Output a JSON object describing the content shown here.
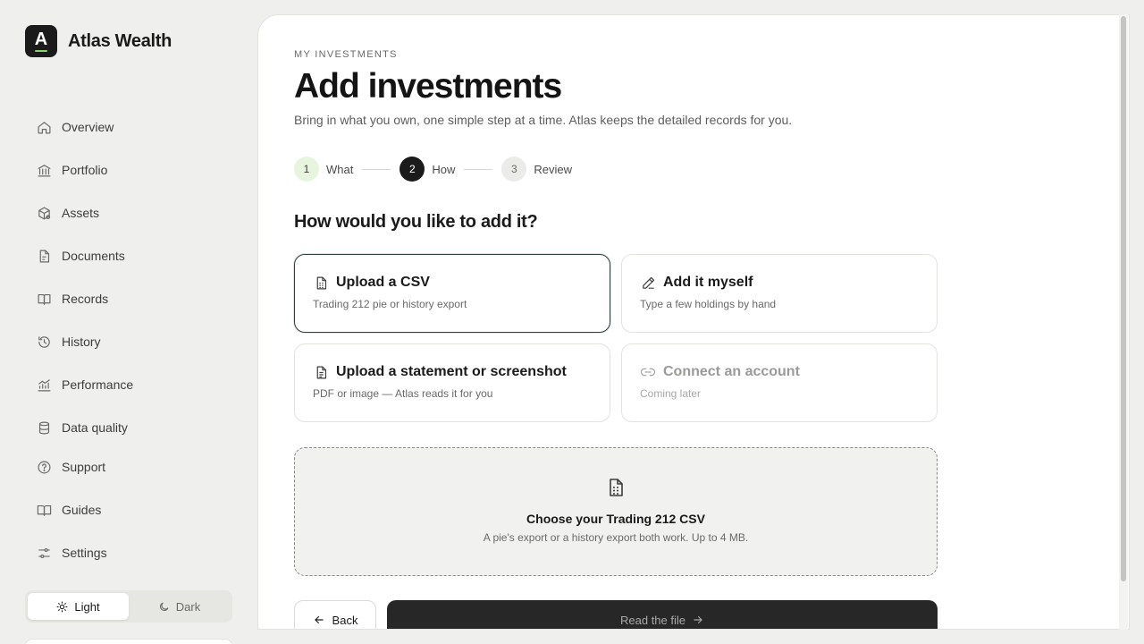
{
  "brand": {
    "logo_letter": "A",
    "name": "Atlas Wealth",
    "accent": "#8ed06b"
  },
  "sidebar": {
    "items": [
      {
        "label": "Overview",
        "icon": "home-icon"
      },
      {
        "label": "Portfolio",
        "icon": "bank-icon"
      },
      {
        "label": "Assets",
        "icon": "assets-icon"
      },
      {
        "label": "Documents",
        "icon": "documents-icon"
      },
      {
        "label": "Records",
        "icon": "records-icon"
      },
      {
        "label": "History",
        "icon": "history-icon"
      },
      {
        "label": "Performance",
        "icon": "performance-icon"
      },
      {
        "label": "Data quality",
        "icon": "database-icon"
      },
      {
        "label": "Support",
        "icon": "help-icon"
      },
      {
        "label": "Guides",
        "icon": "book-icon"
      },
      {
        "label": "Settings",
        "icon": "sliders-icon"
      }
    ]
  },
  "theme": {
    "light_label": "Light",
    "dark_label": "Dark",
    "selected": "Light"
  },
  "page": {
    "eyebrow": "MY INVESTMENTS",
    "title": "Add investments",
    "subtitle": "Bring in what you own, one simple step at a time. Atlas keeps the detailed records for you."
  },
  "stepper": {
    "steps": [
      {
        "num": "1",
        "label": "What",
        "state": "done"
      },
      {
        "num": "2",
        "label": "How",
        "state": "current"
      },
      {
        "num": "3",
        "label": "Review",
        "state": "todo"
      }
    ]
  },
  "question": "How would you like to add it?",
  "options": [
    {
      "title": "Upload a CSV",
      "desc": "Trading 212 pie or history export",
      "icon": "spreadsheet-icon",
      "selected": true
    },
    {
      "title": "Add it myself",
      "desc": "Type a few holdings by hand",
      "icon": "pencil-icon"
    },
    {
      "title": "Upload a statement or screenshot",
      "desc": "PDF or image — Atlas reads it for you",
      "icon": "document-icon"
    },
    {
      "title": "Connect an account",
      "desc": "Coming later",
      "icon": "link-icon",
      "disabled": true
    }
  ],
  "dropzone": {
    "title": "Choose your Trading 212 CSV",
    "desc": "A pie's export or a history export both work. Up to 4 MB.",
    "icon": "csv-file-icon"
  },
  "actions": {
    "back_label": "Back",
    "primary_label": "Read the file"
  }
}
